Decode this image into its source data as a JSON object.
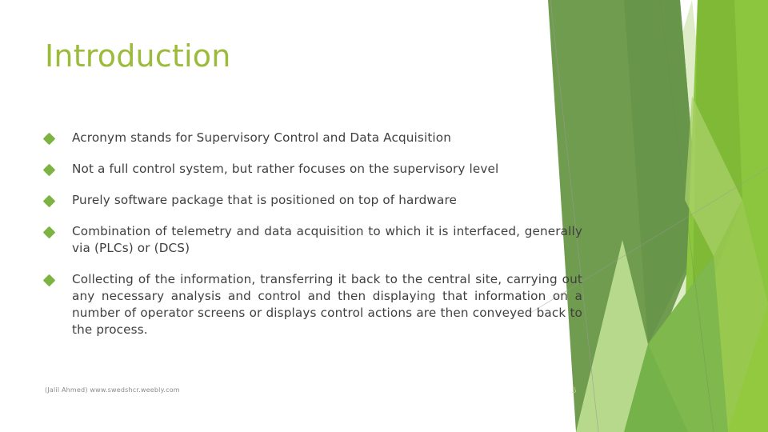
{
  "slide": {
    "title": "Introduction",
    "page_number": "5",
    "footer_credit": "(Jalil Ahmed) www.swedshcr.weebly.com",
    "bullets": [
      {
        "text": "Acronym stands for Supervisory Control and Data Acquisition",
        "justified": false
      },
      {
        "text": "Not a full control system, but rather focuses on the supervisory level",
        "justified": false
      },
      {
        "text": "Purely software package that is positioned on top of hardware",
        "justified": false
      },
      {
        "text": "Combination of telemetry and data acquisition to which it is interfaced, generally via (PLCs) or (DCS)",
        "justified": true
      },
      {
        "text": "Collecting of the information, transferring it back to the central site, carrying out any necessary analysis and control and then displaying that information on a number of operator screens or displays control actions are then conveyed back to the process.",
        "justified": true
      }
    ],
    "colors": {
      "title": "#9cbb3a",
      "body_text": "#3f3f3f",
      "bullet_marker": "#7cb342",
      "page_number": "#b9cf86",
      "footer_credit": "#8a8a8a",
      "background": "#ffffff",
      "facet_dark_green": "#6f9c4f",
      "facet_mid_green": "#76b24a",
      "facet_bright_green": "#8cc63e",
      "facet_light_green": "#a9d169",
      "facet_pale_green": "#d7e8bd",
      "facet_palest_green": "#e9f2dc",
      "facet_line": "#9a9a9a"
    }
  }
}
